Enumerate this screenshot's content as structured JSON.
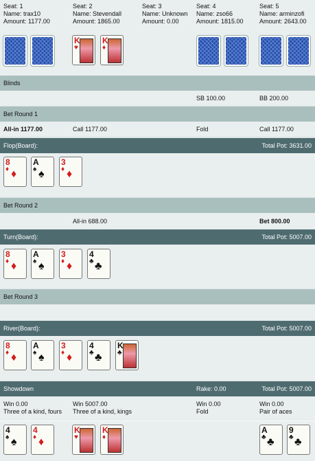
{
  "players": [
    {
      "seat": "Seat: 1",
      "name": "Name: trax10",
      "amount": "Amount: 1177.00"
    },
    {
      "seat": "Seat: 2",
      "name": "Name: Stevendall",
      "amount": "Amount: 1865.00"
    },
    {
      "seat": "Seat: 3",
      "name": "Name: Unknown",
      "amount": "Amount: 0.00"
    },
    {
      "seat": "Seat: 4",
      "name": "Name: zso66",
      "amount": "Amount: 1815.00"
    },
    {
      "seat": "Seat: 5",
      "name": "Name: arminzofi",
      "amount": "Amount: 2643.00"
    }
  ],
  "blinds": {
    "title": "Blinds",
    "sb": "SB 100.00",
    "bb": "BB 200.00"
  },
  "round1": {
    "title": "Bet Round 1",
    "a1": "All-in 1177.00",
    "a2": "Call 1177.00",
    "a4": "Fold",
    "a5": "Call 1177.00"
  },
  "flop": {
    "title": "Flop(Board):",
    "pot": "Total Pot: 3631.00"
  },
  "round2": {
    "title": "Bet Round 2",
    "a2": "All-in 688.00",
    "a5": "Bet 800.00"
  },
  "turn": {
    "title": "Turn(Board):",
    "pot": "Total Pot: 5007.00"
  },
  "round3": {
    "title": "Bet Round 3"
  },
  "river": {
    "title": "River(Board):",
    "pot": "Total Pot: 5007.00"
  },
  "showdown": {
    "title": "Showdown",
    "rake": "Rake: 0.00",
    "pot": "Total Pot: 5007.00"
  },
  "results": [
    {
      "win": "Win 0.00",
      "hand": "Three of a kind, fours"
    },
    {
      "win": "Win 5007.00",
      "hand": "Three of a kind, kings"
    },
    {
      "win": "Win 0.00",
      "hand": "Fold"
    },
    {
      "win": "Win 0.00",
      "hand": "Pair of aces"
    }
  ],
  "cards": {
    "k_hearts": {
      "rank": "K",
      "suit": "♥"
    },
    "k_diamonds": {
      "rank": "K",
      "suit": "♦"
    },
    "eight_d": {
      "rank": "8",
      "suit": "♦"
    },
    "ace_s": {
      "rank": "A",
      "suit": "♠"
    },
    "three_d": {
      "rank": "3",
      "suit": "♦"
    },
    "four_c": {
      "rank": "4",
      "suit": "♣"
    },
    "king_c": {
      "rank": "K",
      "suit": "♣"
    },
    "four_s": {
      "rank": "4",
      "suit": "♠"
    },
    "four_d": {
      "rank": "4",
      "suit": "♦"
    },
    "ace_c": {
      "rank": "A",
      "suit": "♣"
    },
    "nine_c": {
      "rank": "9",
      "suit": "♣"
    }
  },
  "colors": {
    "dark_band": "#4e6b70",
    "mid_band": "#a9bfbe",
    "light_row": "#e9efee",
    "card_back": "#2a4da6",
    "red_suit": "#d21d1d"
  }
}
